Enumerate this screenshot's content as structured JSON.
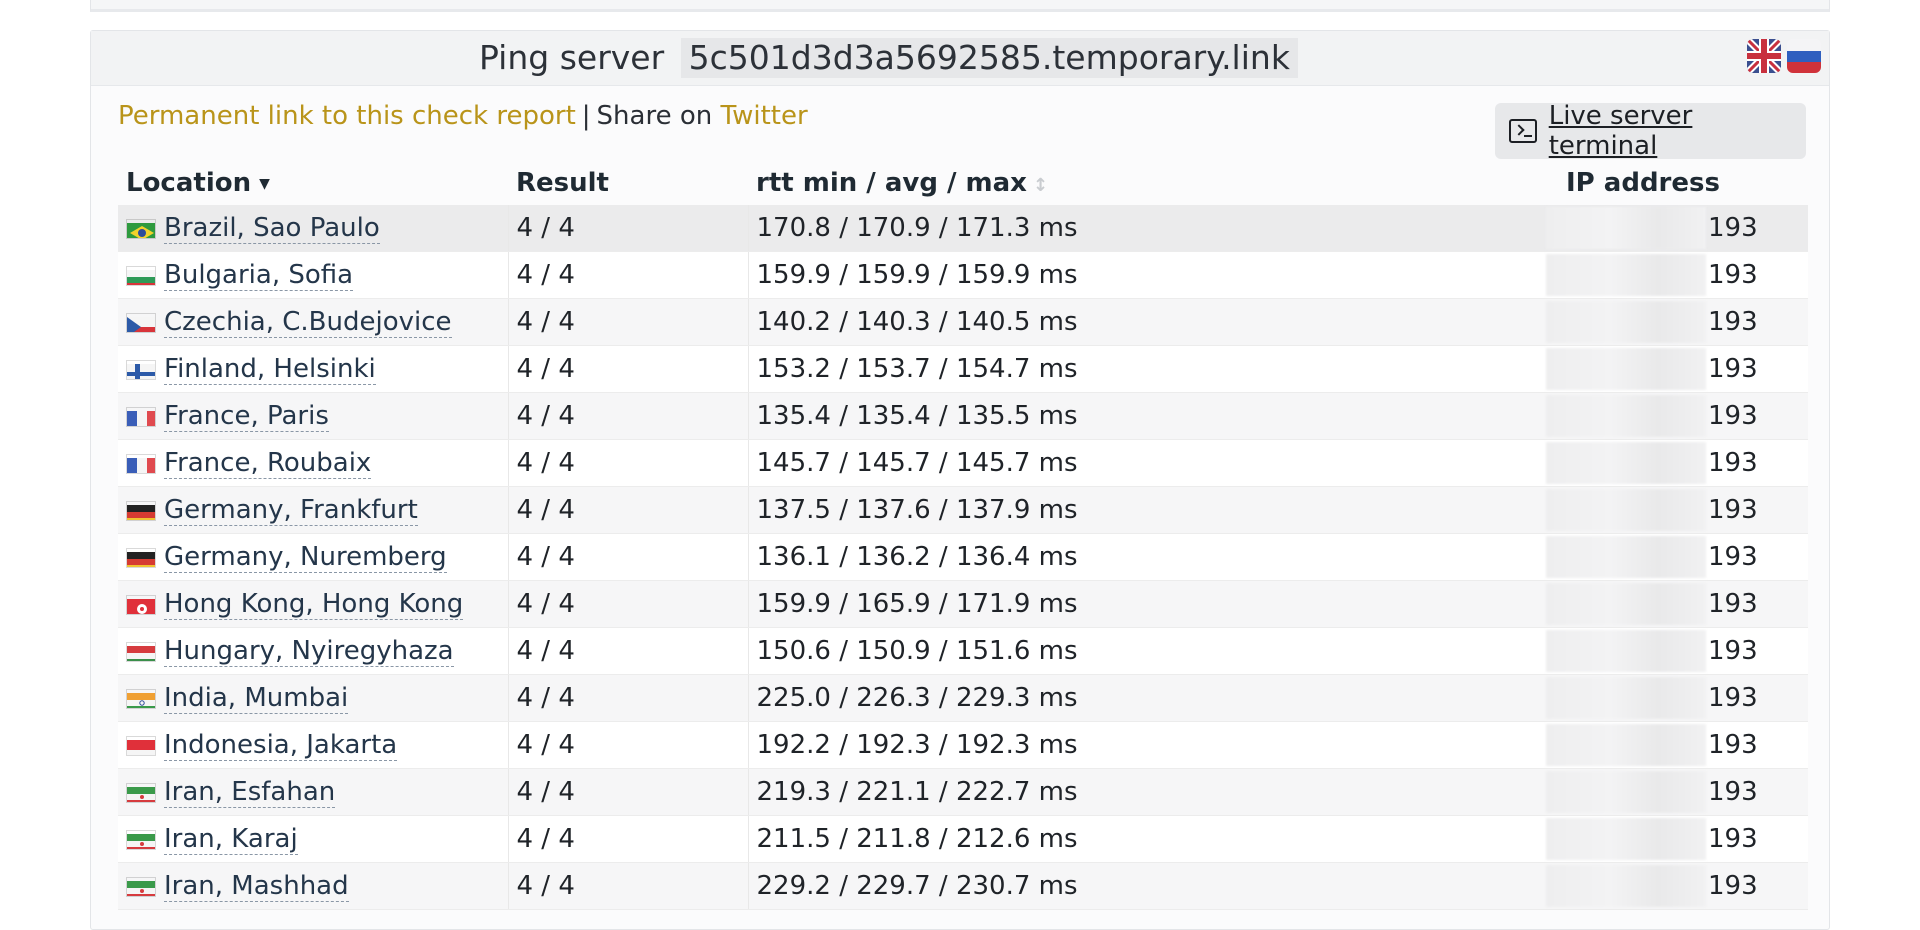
{
  "header": {
    "title_prefix": "Ping server",
    "host": "5c501d3d3a5692585.temporary.link"
  },
  "links": {
    "permanent": "Permanent link to this check report",
    "share_prefix": "Share on",
    "twitter": "Twitter"
  },
  "terminal_button": {
    "label": "Live server terminal"
  },
  "table": {
    "headers": {
      "location": "Location",
      "location_sort": "▼",
      "result": "Result",
      "rtt": "rtt min / avg / max",
      "rtt_sort": "↕",
      "ip": "IP address"
    },
    "rows": [
      {
        "flag": "br",
        "location": "Brazil, Sao Paulo",
        "result": "4 / 4",
        "rtt": "170.8 / 170.9 / 171.3 ms",
        "ip": "193"
      },
      {
        "flag": "bg",
        "location": "Bulgaria, Sofia",
        "result": "4 / 4",
        "rtt": "159.9 / 159.9 / 159.9 ms",
        "ip": "193"
      },
      {
        "flag": "cz",
        "location": "Czechia, C.Budejovice",
        "result": "4 / 4",
        "rtt": "140.2 / 140.3 / 140.5 ms",
        "ip": "193"
      },
      {
        "flag": "fi",
        "location": "Finland, Helsinki",
        "result": "4 / 4",
        "rtt": "153.2 / 153.7 / 154.7 ms",
        "ip": "193"
      },
      {
        "flag": "fr",
        "location": "France, Paris",
        "result": "4 / 4",
        "rtt": "135.4 / 135.4 / 135.5 ms",
        "ip": "193"
      },
      {
        "flag": "fr",
        "location": "France, Roubaix",
        "result": "4 / 4",
        "rtt": "145.7 / 145.7 / 145.7 ms",
        "ip": "193"
      },
      {
        "flag": "de",
        "location": "Germany, Frankfurt",
        "result": "4 / 4",
        "rtt": "137.5 / 137.6 / 137.9 ms",
        "ip": "193"
      },
      {
        "flag": "de",
        "location": "Germany, Nuremberg",
        "result": "4 / 4",
        "rtt": "136.1 / 136.2 / 136.4 ms",
        "ip": "193"
      },
      {
        "flag": "hk",
        "location": "Hong Kong, Hong Kong",
        "result": "4 / 4",
        "rtt": "159.9 / 165.9 / 171.9 ms",
        "ip": "193"
      },
      {
        "flag": "hu",
        "location": "Hungary, Nyiregyhaza",
        "result": "4 / 4",
        "rtt": "150.6 / 150.9 / 151.6 ms",
        "ip": "193"
      },
      {
        "flag": "in",
        "location": "India, Mumbai",
        "result": "4 / 4",
        "rtt": "225.0 / 226.3 / 229.3 ms",
        "ip": "193"
      },
      {
        "flag": "id",
        "location": "Indonesia, Jakarta",
        "result": "4 / 4",
        "rtt": "192.2 / 192.3 / 192.3 ms",
        "ip": "193"
      },
      {
        "flag": "ir",
        "location": "Iran, Esfahan",
        "result": "4 / 4",
        "rtt": "219.3 / 221.1 / 222.7 ms",
        "ip": "193"
      },
      {
        "flag": "ir",
        "location": "Iran, Karaj",
        "result": "4 / 4",
        "rtt": "211.5 / 211.8 / 212.6 ms",
        "ip": "193"
      },
      {
        "flag": "ir",
        "location": "Iran, Mashhad",
        "result": "4 / 4",
        "rtt": "229.2 / 229.7 / 230.7 ms",
        "ip": "193"
      }
    ]
  },
  "colors": {
    "link": "#b9941a",
    "accent_text": "#24364a"
  }
}
